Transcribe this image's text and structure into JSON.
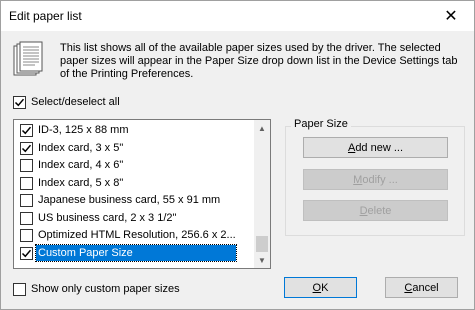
{
  "window": {
    "title": "Edit paper list",
    "close_glyph": "✕"
  },
  "info": {
    "icon": "document-stack-icon",
    "text": "This list shows all of the available paper sizes used by the driver. The selected paper sizes will appear in the Paper Size drop down list in the Device Settings tab of the Printing Preferences."
  },
  "select_all": {
    "label": "Select/deselect all",
    "checked": true
  },
  "paper_list": {
    "items": [
      {
        "label": "ID-3, 125 x 88 mm",
        "checked": true
      },
      {
        "label": "Index card, 3 x 5\"",
        "checked": true
      },
      {
        "label": "Index card, 4 x 6\"",
        "checked": false
      },
      {
        "label": "Index card, 5 x 8\"",
        "checked": false
      },
      {
        "label": "Japanese business card, 55 x 91 mm",
        "checked": false
      },
      {
        "label": "US business card, 2 x 3 1/2\"",
        "checked": false
      },
      {
        "label": "Optimized HTML Resolution, 256.6 x 2...",
        "checked": false
      },
      {
        "label": "Custom Paper Size",
        "checked": true,
        "selected": true
      }
    ]
  },
  "paper_size_group": {
    "title": "Paper Size",
    "add_new": {
      "pre": "",
      "u": "A",
      "post": "dd new ..."
    },
    "modify": {
      "pre": "",
      "u": "M",
      "post": "odify ..."
    },
    "delete": {
      "pre": "",
      "u": "D",
      "post": "elete"
    }
  },
  "show_custom": {
    "label": "Show only custom paper sizes",
    "checked": false
  },
  "ok": {
    "pre": "",
    "u": "O",
    "post": "K"
  },
  "cancel": {
    "pre": "",
    "u": "C",
    "post": "ancel"
  },
  "colors": {
    "accent": "#0078d7",
    "background": "#f0f0f0"
  }
}
